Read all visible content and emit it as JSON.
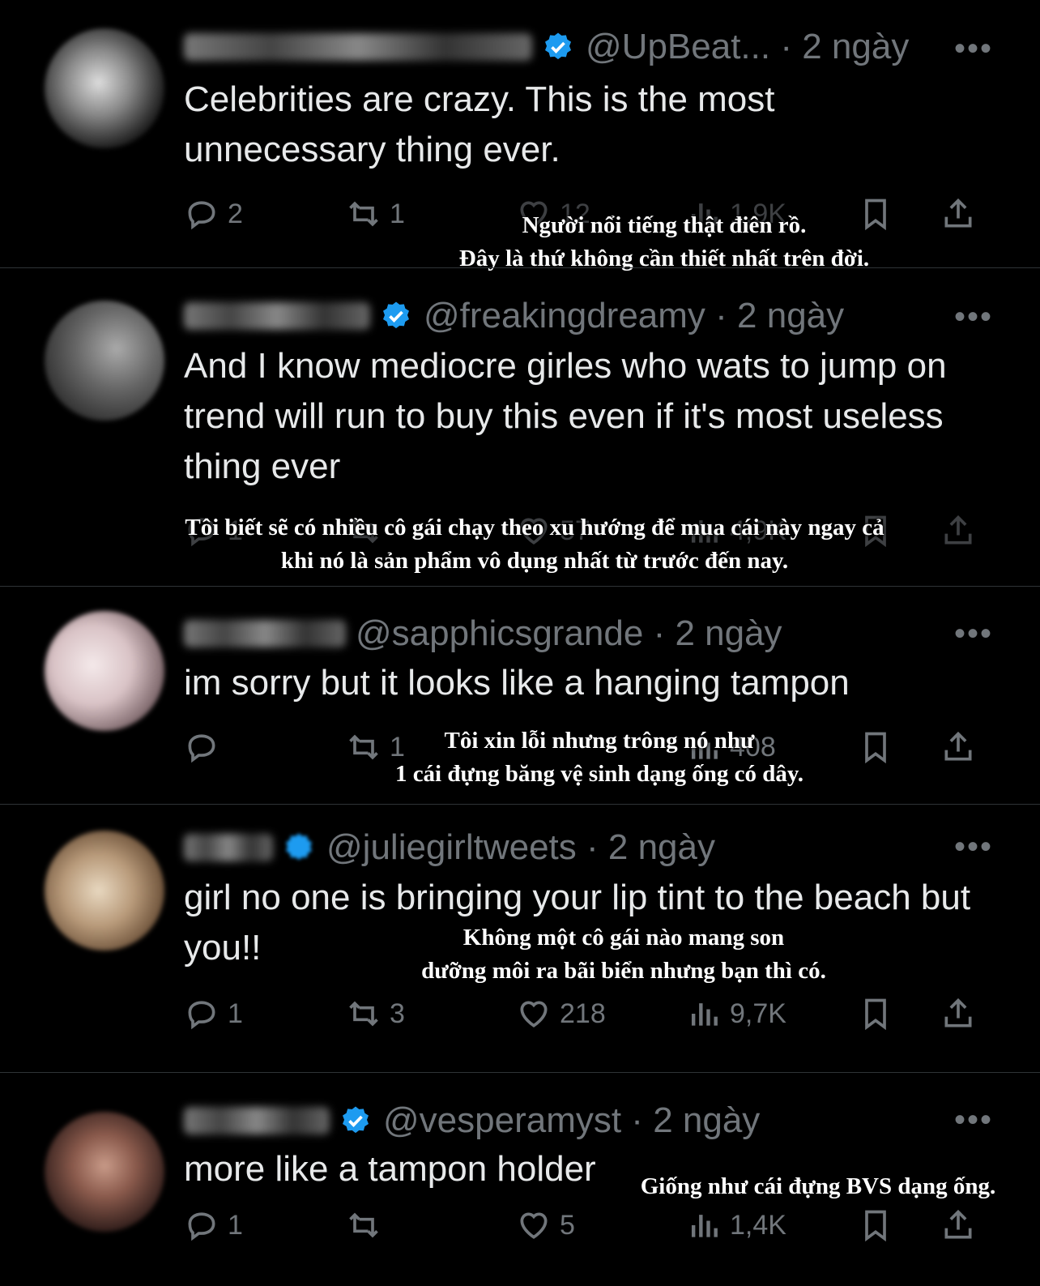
{
  "colors": {
    "background": "#000000",
    "text": "#e7e9ea",
    "muted": "#71767b",
    "verified": "#1d9bf0",
    "divider": "#2f3336"
  },
  "tweets": [
    {
      "handle": "@UpBeat...",
      "time": "2 ngày",
      "more": "•••",
      "text": "Celebrities are crazy. This is the most unnecessary thing ever.",
      "replies": "2",
      "reposts": "1",
      "likes": "12",
      "views": "1,9K",
      "caption": [
        "Người nổi tiếng thật điên rồ.",
        "Đây là thứ không cần thiết nhất trên đời."
      ]
    },
    {
      "handle": "@freakingdreamy",
      "time": "2 ngày",
      "more": "•••",
      "text": "And I know mediocre girles who wats to jump on trend will run to buy this even if it's most useless thing ever",
      "replies": "1",
      "reposts": "",
      "likes": "57",
      "views": "4,9K",
      "caption": [
        "Tôi biết sẽ có nhiều cô gái chạy theo xu hướng để mua cái này ngay cả",
        "khi nó là sản phẩm vô dụng nhất từ trước đến nay."
      ]
    },
    {
      "handle": "@sapphicsgrande",
      "time": "2 ngày",
      "more": "•••",
      "text": "im sorry but it looks like a hanging tampon",
      "replies": "",
      "reposts": "1",
      "likes": "",
      "views": "408",
      "caption": [
        "Tôi xin lỗi nhưng trông nó như",
        "1 cái đựng băng vệ sinh dạng ống có dây."
      ]
    },
    {
      "handle": "@juliegirltweets",
      "time": "2 ngày",
      "more": "•••",
      "text": "girl no one is bringing your lip tint to the beach but you!!",
      "replies": "1",
      "reposts": "3",
      "likes": "218",
      "views": "9,7K",
      "caption": [
        "Không một cô gái nào mang son",
        "dưỡng môi ra bãi biển nhưng bạn thì có."
      ]
    },
    {
      "handle": "@vesperamyst",
      "time": "2 ngày",
      "more": "•••",
      "text": "more like a tampon holder",
      "replies": "1",
      "reposts": "",
      "likes": "5",
      "views": "1,4K",
      "caption": [
        "Giống như cái đựng BVS dạng ống."
      ]
    }
  ]
}
